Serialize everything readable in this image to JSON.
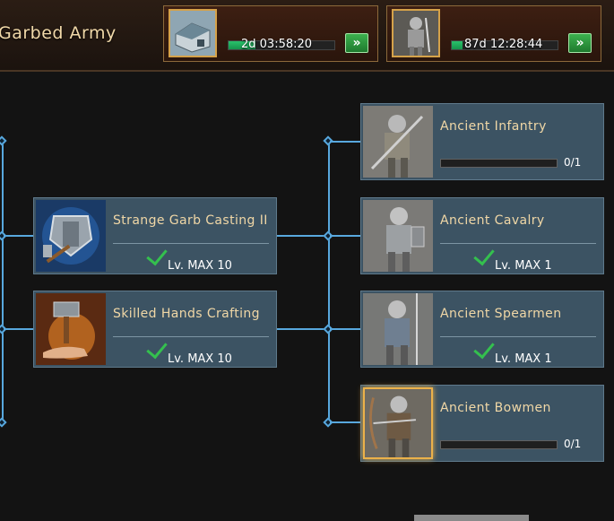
{
  "header": {
    "title": "Garbed Army",
    "queues": [
      {
        "thumb_icon": "building-icon",
        "time": "2d 03:58:20",
        "progress": 0.25,
        "go_icon": "fast-forward-icon"
      },
      {
        "thumb_icon": "knight-icon",
        "time": "87d 12:28:44",
        "progress": 0.1,
        "go_icon": "fast-forward-icon"
      }
    ]
  },
  "skills": [
    {
      "name": "Strange Garb Casting II",
      "level": "Lv. MAX 10",
      "icon": "armor-hammer-icon"
    },
    {
      "name": "Skilled Hands Crafting",
      "level": "Lv. MAX 10",
      "icon": "forging-hammer-icon"
    }
  ],
  "units": [
    {
      "name": "Ancient Infantry",
      "count": "0/1",
      "progress": 0,
      "icon": "infantry-icon"
    },
    {
      "name": "Ancient Cavalry",
      "level": "Lv. MAX 1",
      "icon": "cavalry-icon"
    },
    {
      "name": "Ancient Spearmen",
      "level": "Lv. MAX 1",
      "icon": "spearmen-icon"
    },
    {
      "name": "Ancient Bowmen",
      "count": "0/1",
      "progress": 0,
      "icon": "bowmen-icon"
    }
  ],
  "colors": {
    "connector": "#58a8de",
    "selected": "#ebb14a",
    "check": "#34c04e"
  }
}
